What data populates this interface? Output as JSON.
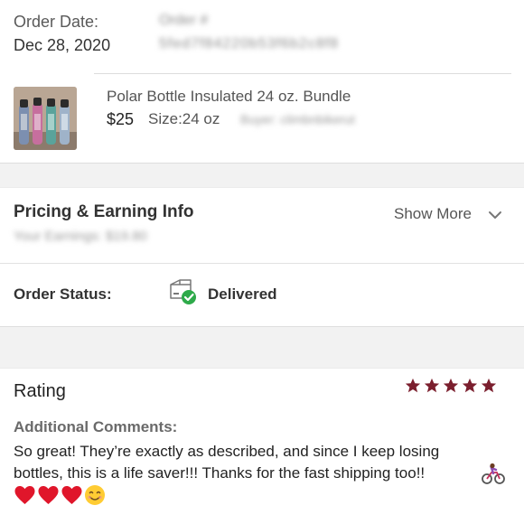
{
  "order": {
    "date_label": "Order Date:",
    "date_value": "Dec 28, 2020",
    "number_label": "Order #",
    "number_value": "5fed7f84220b53f6b2c8f8"
  },
  "product": {
    "title": "Polar Bottle Insulated 24 oz. Bundle",
    "price": "$25",
    "size": "Size:24 oz",
    "buyer": "Buyer: climbnbikerut"
  },
  "pricing": {
    "title": "Pricing & Earning Info",
    "earnings": "Your Earnings: $19.80",
    "show_more": "Show More"
  },
  "status": {
    "label": "Order Status:",
    "value": "Delivered"
  },
  "rating": {
    "title": "Rating",
    "stars": 5,
    "star_color": "#7b1f2e",
    "comments_label": "Additional Comments:",
    "comment_line1": "So great! They’re exactly as described, and since I keep losing",
    "comment_line2": "bottles, this is a life saver!!! Thanks for the fast shipping too!!"
  },
  "icons": {
    "status": "package-delivered-icon",
    "chevron": "chevron-down-icon",
    "bike": "woman-biking-emoji",
    "heart": "red-heart-emoji",
    "smile": "smiling-face-emoji"
  },
  "colors": {
    "delivered_check": "#2eaa4a",
    "heart": "#e0162b",
    "section_gap": "#f2f2f2"
  }
}
